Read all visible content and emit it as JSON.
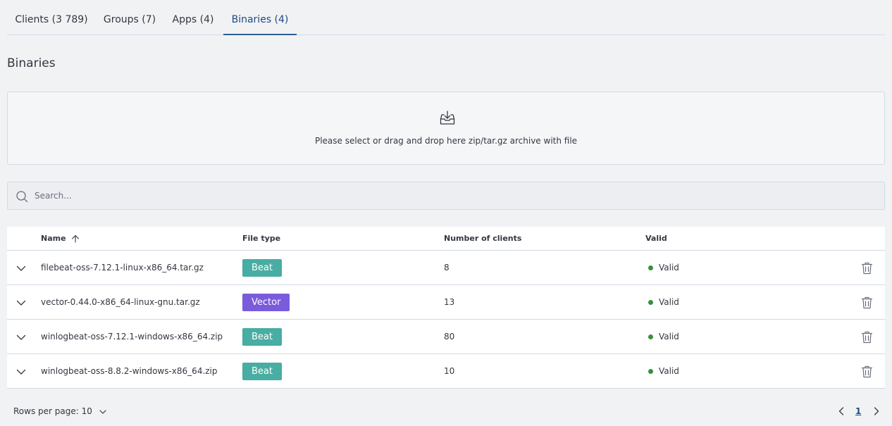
{
  "tabs": [
    {
      "label": "Clients (3 789)"
    },
    {
      "label": "Groups (7)"
    },
    {
      "label": "Apps (4)"
    },
    {
      "label": "Binaries (4)"
    }
  ],
  "page": {
    "title": "Binaries"
  },
  "upload": {
    "icon": "download-tray-icon",
    "text": "Please select or drag and drop here zip/tar.gz archive with file"
  },
  "search": {
    "icon": "search-icon",
    "placeholder": "Search...",
    "value": ""
  },
  "table": {
    "columns": {
      "name": "Name",
      "file_type": "File type",
      "clients": "Number of clients",
      "valid": "Valid"
    },
    "sort": {
      "column": "Name",
      "direction": "ascending",
      "icon": "arrow-up-icon"
    },
    "rows": [
      {
        "name": "filebeat-oss-7.12.1-linux-x86_64.tar.gz",
        "type": "Beat",
        "clients": "8",
        "status": "Valid"
      },
      {
        "name": "vector-0.44.0-x86_64-linux-gnu.tar.gz",
        "type": "Vector",
        "clients": "13",
        "status": "Valid"
      },
      {
        "name": "winlogbeat-oss-7.12.1-windows-x86_64.zip",
        "type": "Beat",
        "clients": "80",
        "status": "Valid"
      },
      {
        "name": "winlogbeat-oss-8.8.2-windows-x86_64.zip",
        "type": "Beat",
        "clients": "10",
        "status": "Valid"
      }
    ]
  },
  "pagination": {
    "rows_per_page_label": "Rows per page: 10",
    "current_page": "1"
  },
  "colors": {
    "beat_badge": "#48ada2",
    "vector_badge": "#7a5bdc",
    "valid_dot": "#3c8f3c",
    "active_tab": "#1f4b80"
  }
}
